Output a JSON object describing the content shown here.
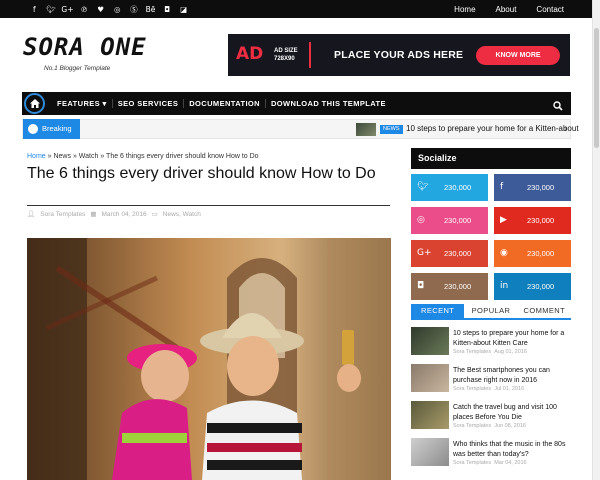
{
  "topbar": {
    "social_icons": [
      "facebook-icon",
      "twitter-icon",
      "google-plus-icon",
      "pinterest-icon",
      "heart-icon",
      "dribbble-icon",
      "skype-icon",
      "behance-icon",
      "instagram-icon",
      "delicious-icon"
    ],
    "links": [
      "Home",
      "About",
      "Contact"
    ]
  },
  "header": {
    "logo": "SORA ONE",
    "tagline": "No.1 Blogger Template",
    "ad": {
      "big": "AD",
      "size_line1": "AD SIZE",
      "size_line2": "728X90",
      "text": "PLACE YOUR ADS HERE",
      "button": "KNOW MORE"
    }
  },
  "nav": {
    "items": [
      "FEATURES ▾",
      "SEO SERVICES",
      "DOCUMENTATION",
      "DOWNLOAD THIS TEMPLATE"
    ]
  },
  "breaking": {
    "label": "Breaking",
    "tag": "NEWS",
    "headline": "10 steps to prepare your home for a Kitten-about"
  },
  "post": {
    "crumbs": [
      "Home",
      "News",
      "Watch",
      "The 6 things every driver should know How to Do"
    ],
    "title": "The 6 things every driver should know How to Do",
    "author": "Sora Templates",
    "date": "March 04, 2016",
    "labels": "News, Watch"
  },
  "sidebar": {
    "socialize_title": "Socialize",
    "social_tiles": [
      {
        "icon": "twitter-icon",
        "glyph": "t",
        "count": "230,000",
        "color": "#23a7e0"
      },
      {
        "icon": "facebook-icon",
        "glyph": "f",
        "count": "230,000",
        "color": "#3d5a99"
      },
      {
        "icon": "dribbble-icon",
        "glyph": "◎",
        "count": "230,000",
        "color": "#ea4d89"
      },
      {
        "icon": "youtube-icon",
        "glyph": "▶",
        "count": "230,000",
        "color": "#e02a20"
      },
      {
        "icon": "google-plus-icon",
        "glyph": "G+",
        "count": "230,000",
        "color": "#d9432f"
      },
      {
        "icon": "rss-icon",
        "glyph": "◉",
        "count": "230,000",
        "color": "#f26b24"
      },
      {
        "icon": "instagram-icon",
        "glyph": "◘",
        "count": "230,000",
        "color": "#8f6a4e"
      },
      {
        "icon": "linkedin-icon",
        "glyph": "in",
        "count": "230,000",
        "color": "#0f80bd"
      }
    ],
    "tabs": [
      "RECENT",
      "POPULAR",
      "COMMENT"
    ],
    "recent": [
      {
        "title": "10 steps to prepare your home for a Kitten-about Kitten Care",
        "author": "Sora Templates",
        "date": "Aug 01, 2016"
      },
      {
        "title": "The Best smartphones you can purchase right now in 2016",
        "author": "Sora Templates",
        "date": "Jul 01, 2016"
      },
      {
        "title": "Catch the travel bug and visit 100 places Before You Die",
        "author": "Sora Templates",
        "date": "Jun 08, 2016"
      },
      {
        "title": "Who thinks that the music in the 80s was better than today's?",
        "author": "Sora Templates",
        "date": "Mar 04, 2016"
      }
    ]
  }
}
